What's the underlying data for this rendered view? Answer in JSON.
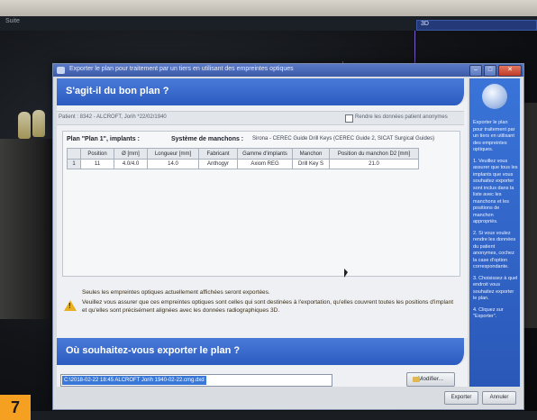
{
  "app_bar": {
    "label": "Suite"
  },
  "viewer": {
    "badge": "3D"
  },
  "dialog": {
    "title": "Exporter le plan pour traitement par un tiers en utilisant des empreintes optiques",
    "banner_question": "S'agit-il du bon plan ?",
    "patient": "Patient : 8342 - ALCROFT, Jorih *22/02/1940",
    "anonymize_label": "Rendre les données patient anonymes",
    "plan_title": "Plan \"Plan 1\", implants :",
    "sleeve_system_label": "Système de manchons :",
    "sleeve_system_value": "Sirona - CEREC Guide Drill Keys (CEREC Guide 2, SICAT Surgical Guides)",
    "table": {
      "headers": [
        "",
        "Position",
        "Ø [mm]",
        "Longueur [mm]",
        "Fabricant",
        "Gamme d'implants",
        "Manchon",
        "Position du manchon D2 [mm]"
      ],
      "rows": [
        [
          "1",
          "11",
          "4.0/4.0",
          "14.0",
          "Anthogyr",
          "Axiom REG",
          "Drill Key S",
          "21.0"
        ]
      ]
    },
    "warning_line1": "Seules les empreintes optiques actuellement affichées seront exportées.",
    "warning_line2": "Veuillez vous assurer que ces empreintes optiques sont celles qui sont destinées à l'exportation, qu'elles couvrent toutes les positions d'implant et qu'elles sont précisément alignées avec les données radiographiques 3D.",
    "export_question": "Où souhaitez-vous exporter le plan ?",
    "export_path": "C:\\2018-02-22 18:45 ALCROFT Jorih 1940-02-22.cmg.dxd",
    "modify_button": "Modifier...",
    "export_button": "Exporter",
    "cancel_button": "Annuler"
  },
  "sidebar": {
    "paragraphs": [
      "Exporter le plan pour traitement par un tiers en utilisant des empreintes optiques.",
      "1. Veuillez vous assurer que tous les implants que vous souhaitez exporter sont inclus dans la liste avec les manchons et les positions de manchon appropriés.",
      "2. Si vous voulez rendre les données du patient anonymes, cochez la case d'option correspondante.",
      "3. Choisissez à quel endroit vous souhaitez exporter le plan.",
      "4. Cliquez sur \"Exporter\"."
    ]
  },
  "figure_number": "7",
  "colors": {
    "banner_blue": "#2c5cc0",
    "sidebar_blue": "#2a58b8",
    "figure_badge": "#f5a020",
    "warning_yellow": "#e8b020"
  }
}
